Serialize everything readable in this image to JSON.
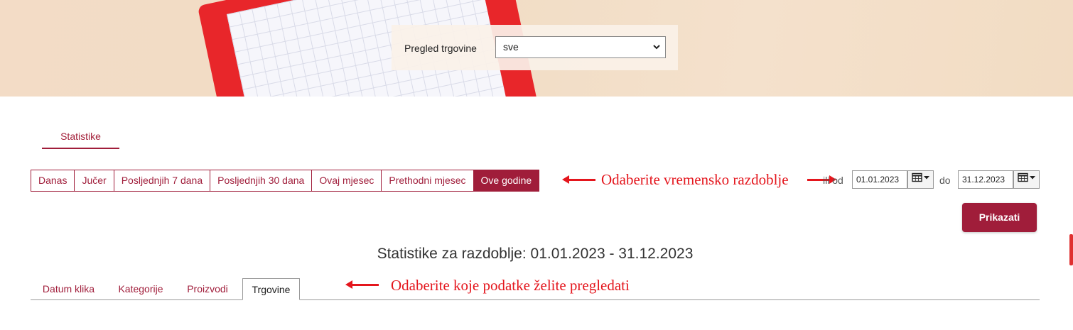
{
  "store_filter": {
    "label": "Pregled trgovine",
    "selected": "sve"
  },
  "main_tab": {
    "label": "Statistike"
  },
  "range_buttons": [
    {
      "label": "Danas",
      "active": false
    },
    {
      "label": "Jučer",
      "active": false
    },
    {
      "label": "Posljednjih 7 dana",
      "active": false
    },
    {
      "label": "Posljednjih 30 dana",
      "active": false
    },
    {
      "label": "Ovaj mjesec",
      "active": false
    },
    {
      "label": "Prethodni mjesec",
      "active": false
    },
    {
      "label": "Ove godine",
      "active": true
    }
  ],
  "annotations": {
    "period": "Odaberite vremensko razdoblje",
    "data": "Odaberite koje podatke želite pregledati"
  },
  "date_range": {
    "or_label": "ili od",
    "from": "01.01.2023",
    "to_label": "do",
    "to": "31.12.2023"
  },
  "show_button": "Prikazati",
  "period_title": "Statistike za razdoblje: 01.01.2023 - 31.12.2023",
  "data_tabs": [
    {
      "label": "Datum klika",
      "active": false
    },
    {
      "label": "Kategorije",
      "active": false
    },
    {
      "label": "Proizvodi",
      "active": false
    },
    {
      "label": "Trgovine",
      "active": true
    }
  ],
  "colors": {
    "accent": "#a01d3a",
    "annotation": "#e4161d"
  },
  "icons": {
    "calendar": "calendar-icon",
    "dropdown": "chevron-down-icon"
  }
}
